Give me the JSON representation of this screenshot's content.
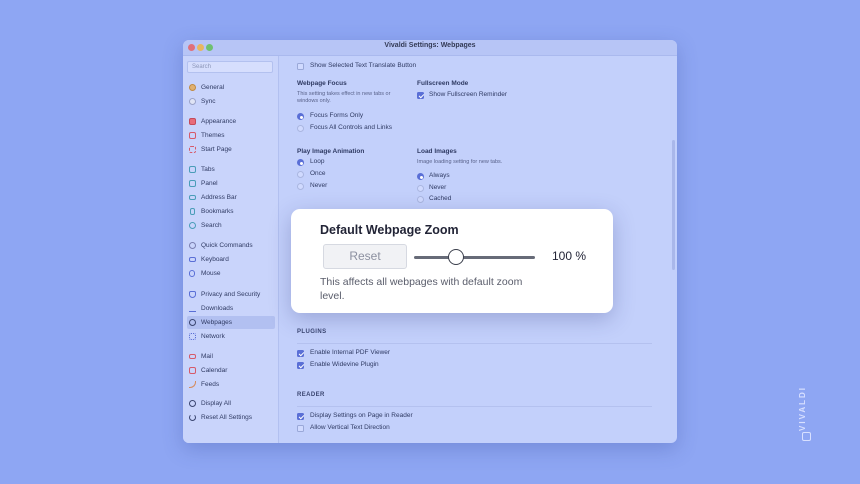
{
  "window": {
    "title": "Vivaldi Settings: Webpages"
  },
  "sidebar": {
    "search_placeholder": "Search",
    "items": [
      {
        "label": "General",
        "icon": "gear-icon"
      },
      {
        "label": "Sync",
        "icon": "cloud-icon"
      },
      {
        "label": "Appearance",
        "icon": "appearance-icon"
      },
      {
        "label": "Themes",
        "icon": "brush-icon"
      },
      {
        "label": "Start Page",
        "icon": "grid-icon"
      },
      {
        "label": "Tabs",
        "icon": "tabs-icon"
      },
      {
        "label": "Panel",
        "icon": "panel-icon"
      },
      {
        "label": "Address Bar",
        "icon": "address-bar-icon"
      },
      {
        "label": "Bookmarks",
        "icon": "bookmark-icon"
      },
      {
        "label": "Search",
        "icon": "search-icon"
      },
      {
        "label": "Quick Commands",
        "icon": "quick-commands-icon"
      },
      {
        "label": "Keyboard",
        "icon": "keyboard-icon"
      },
      {
        "label": "Mouse",
        "icon": "mouse-icon"
      },
      {
        "label": "Privacy and Security",
        "icon": "shield-icon"
      },
      {
        "label": "Downloads",
        "icon": "download-icon"
      },
      {
        "label": "Webpages",
        "icon": "globe-icon",
        "active": true
      },
      {
        "label": "Network",
        "icon": "network-icon"
      },
      {
        "label": "Mail",
        "icon": "mail-icon"
      },
      {
        "label": "Calendar",
        "icon": "calendar-icon"
      },
      {
        "label": "Feeds",
        "icon": "rss-icon"
      },
      {
        "label": "Display All",
        "icon": "gear-icon"
      },
      {
        "label": "Reset All Settings",
        "icon": "power-icon"
      }
    ]
  },
  "content": {
    "translate_label": "Show Selected Text Translate Button",
    "webpage_focus": {
      "title": "Webpage Focus",
      "desc": "This setting takes effect in new tabs or windows only.",
      "options": [
        "Focus Forms Only",
        "Focus All Controls and Links"
      ],
      "selected": "Focus Forms Only"
    },
    "fullscreen": {
      "title": "Fullscreen Mode",
      "reminder_label": "Show Fullscreen Reminder",
      "reminder_checked": true
    },
    "image_animation": {
      "title": "Play Image Animation",
      "options": [
        "Loop",
        "Once",
        "Never"
      ],
      "selected": "Loop"
    },
    "load_images": {
      "title": "Load Images",
      "desc": "Image loading setting for new tabs.",
      "options": [
        "Always",
        "Never",
        "Cached"
      ],
      "selected": "Always"
    },
    "plugins": {
      "title": "PLUGINS",
      "items": [
        {
          "label": "Enable Internal PDF Viewer",
          "checked": true
        },
        {
          "label": "Enable Widevine Plugin",
          "checked": true
        }
      ]
    },
    "reader": {
      "title": "READER",
      "items": [
        {
          "label": "Display Settings on Page in Reader",
          "checked": true
        },
        {
          "label": "Allow Vertical Text Direction",
          "checked": false
        }
      ]
    }
  },
  "zoom_popup": {
    "title": "Default Webpage Zoom",
    "reset_label": "Reset",
    "zoom_value": "100 %",
    "slider_fraction": 0.35,
    "description": "This affects all webpages with default zoom level."
  },
  "branding": {
    "wordmark": "VIVALDI"
  }
}
